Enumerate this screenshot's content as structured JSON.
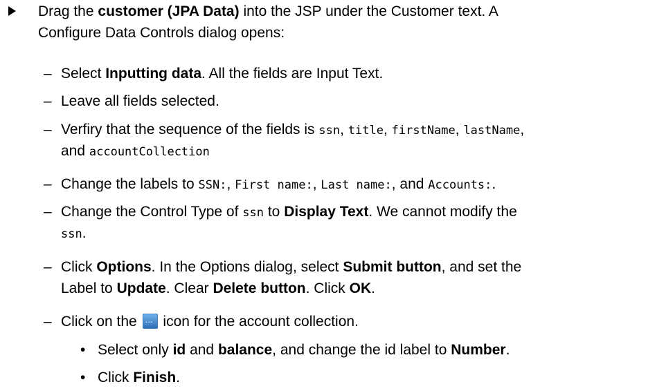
{
  "intro": {
    "t1": "Drag the ",
    "b1": "customer (JPA Data)",
    "t2": " into the JSP under the Customer text. A",
    "line2": "Configure Data Controls dialog opens:"
  },
  "dash_symbol": "–",
  "bullet_symbol": "•",
  "steps": [
    {
      "t1": "Select ",
      "b1": "Inputting data",
      "t2": ". All the fields are Input Text."
    },
    {
      "t1": "Leave all fields selected."
    },
    {
      "t1": "Verfiry that the sequence of the fields is ",
      "c1": "ssn",
      "t2": ", ",
      "c2": "title",
      "t3": ", ",
      "c3": "firstName",
      "t4": ", ",
      "c4": "lastName",
      "t5": ",",
      "line2_t1": "and ",
      "line2_c1": "accountCollection"
    },
    {
      "t1": "Change the labels to ",
      "c1": "SSN:",
      "t2": ", ",
      "c2": "First name:",
      "t3": ", ",
      "c3": "Last name:",
      "t4": ", and ",
      "c4": "Accounts:",
      "t5": "."
    },
    {
      "t1": "Change the Control Type of ",
      "c1": "ssn",
      "t2": " to ",
      "b1": "Display Text",
      "t3": ". We cannot modify the",
      "line2_c1": "ssn",
      "line2_t1": "."
    },
    {
      "t1": "Click ",
      "b1": "Options",
      "t2": ". In the Options dialog, select ",
      "b2": "Submit button",
      "t3": ", and set the",
      "line2_t1": "Label to ",
      "line2_b1": "Update",
      "line2_t2": ". Clear ",
      "line2_b2": "Delete button",
      "line2_t3": ". Click ",
      "line2_b3": "OK",
      "line2_t4": "."
    },
    {
      "t1": "Click on the ",
      "t2": " icon for the account collection."
    }
  ],
  "substeps": [
    {
      "t1": "Select only ",
      "b1": "id",
      "t2": " and ",
      "b2": "balance",
      "t3": ", and change the id label to ",
      "b3": "Number",
      "t4": "."
    },
    {
      "t1": "Click ",
      "b1": "Finish",
      "t2": "."
    }
  ]
}
